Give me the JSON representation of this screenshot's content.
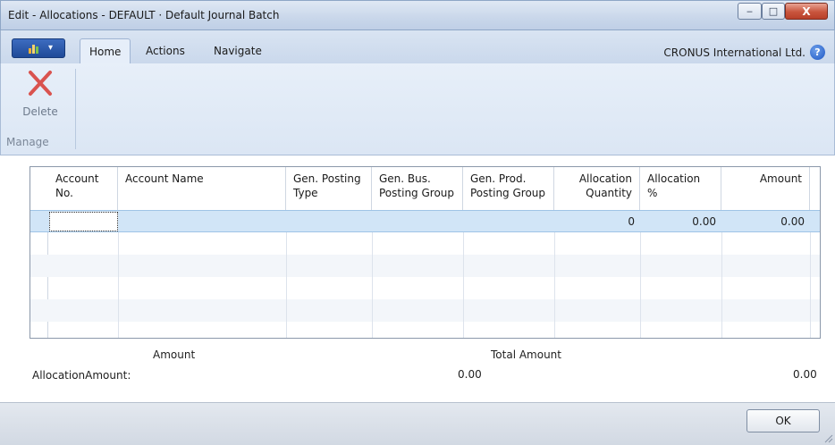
{
  "window": {
    "title": "Edit - Allocations - DEFAULT · Default Journal Batch",
    "minimize_glyph": "‒",
    "maximize_glyph": "□",
    "close_glyph": "X"
  },
  "ribbon": {
    "tabs": [
      {
        "label": "Home",
        "active": true
      },
      {
        "label": "Actions",
        "active": false
      },
      {
        "label": "Navigate",
        "active": false
      }
    ],
    "company": "CRONUS International Ltd.",
    "help_glyph": "?",
    "delete_label": "Delete",
    "group_label": "Manage"
  },
  "grid": {
    "columns": [
      {
        "label": "Account No."
      },
      {
        "label": "Account Name"
      },
      {
        "label": "Gen. Posting Type"
      },
      {
        "label": "Gen. Bus. Posting Group"
      },
      {
        "label": "Gen. Prod. Posting Group"
      },
      {
        "label": "Allocation Quantity"
      },
      {
        "label": "Allocation %"
      },
      {
        "label": "Amount"
      }
    ],
    "rows": [
      {
        "allocation_quantity": "0",
        "allocation_pct": "0.00",
        "amount": "0.00"
      }
    ]
  },
  "summary": {
    "amount_header": "Amount",
    "total_amount_header": "Total Amount",
    "row_label": "AllocationAmount:",
    "amount_value": "0.00",
    "total_amount_value": "0.00"
  },
  "footer": {
    "ok_label": "OK"
  },
  "colors": {
    "accent": "#1f4a98",
    "selection": "#d1e5f7",
    "delete_red": "#d9534f"
  }
}
